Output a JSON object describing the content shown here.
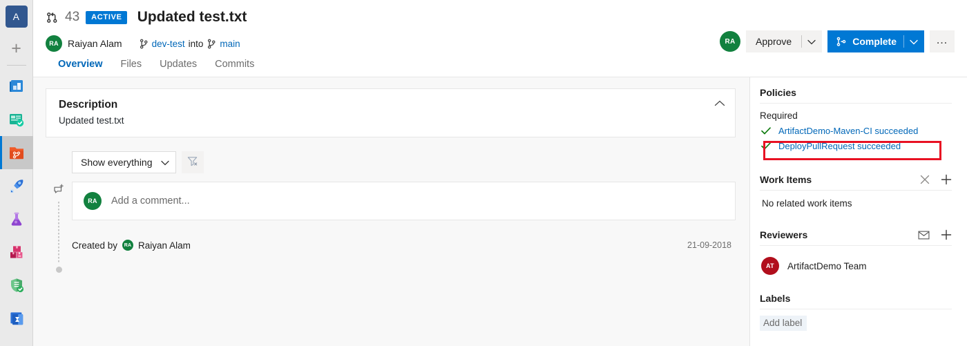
{
  "rail": {
    "org_initial": "A",
    "add_label": "+",
    "items": [
      {
        "name": "boards-icon",
        "label": "Boards"
      },
      {
        "name": "test-plans-icon",
        "label": "Test Plans"
      },
      {
        "name": "repos-icon",
        "label": "Repos"
      },
      {
        "name": "pipelines-icon",
        "label": "Pipelines"
      },
      {
        "name": "lab-icon",
        "label": "Test Lab"
      },
      {
        "name": "artifacts-icon",
        "label": "Artifacts"
      },
      {
        "name": "security-icon",
        "label": "Security"
      },
      {
        "name": "analytics-icon",
        "label": "Analytics"
      }
    ]
  },
  "header": {
    "pr_number": "43",
    "status": "ACTIVE",
    "title": "Updated test.txt",
    "author": {
      "initials": "RA",
      "name": "Raiyan Alam"
    },
    "source_branch": "dev-test",
    "into_text": "into",
    "target_branch": "main",
    "toolbar": {
      "user_initials": "RA",
      "approve_label": "Approve",
      "complete_label": "Complete",
      "more_label": "…"
    }
  },
  "tabs": [
    {
      "label": "Overview",
      "active": true
    },
    {
      "label": "Files",
      "active": false
    },
    {
      "label": "Updates",
      "active": false
    },
    {
      "label": "Commits",
      "active": false
    }
  ],
  "description": {
    "heading": "Description",
    "text": "Updated test.txt"
  },
  "discussion": {
    "filter_value": "Show everything",
    "comment_avatar": "RA",
    "comment_placeholder": "Add a comment...",
    "created_by_label": "Created by",
    "created_by_initials": "RA",
    "created_by_name": "Raiyan Alam",
    "created_date": "21-09-2018"
  },
  "sidebar": {
    "policies": {
      "heading": "Policies",
      "required_label": "Required",
      "items": [
        {
          "check": "✓",
          "text": "ArtifactDemo-Maven-CI succeeded",
          "highlighted": false
        },
        {
          "check": "✓",
          "text": "DeployPullRequest succeeded",
          "highlighted": true
        }
      ],
      "highlight_color": "#e81123"
    },
    "work_items": {
      "heading": "Work Items",
      "empty_text": "No related work items"
    },
    "reviewers": {
      "heading": "Reviewers",
      "items": [
        {
          "initials": "AT",
          "name": "ArtifactDemo Team"
        }
      ]
    },
    "labels": {
      "heading": "Labels",
      "add_label": "Add label"
    }
  },
  "colors": {
    "accent": "#0078d4",
    "link": "#0067b8",
    "success": "#107c10",
    "highlight": "#e81123",
    "avatar_green": "#12813f",
    "avatar_red": "#b10e1c"
  }
}
